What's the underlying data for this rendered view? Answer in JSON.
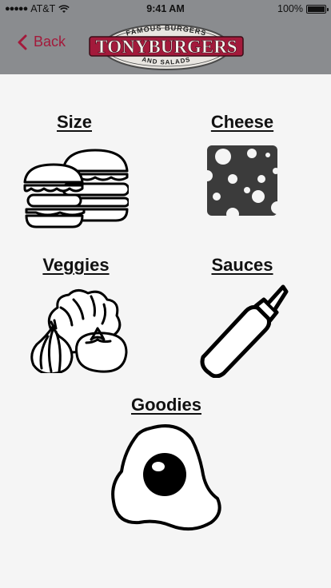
{
  "status_bar": {
    "carrier": "AT&T",
    "time": "9:41 AM",
    "battery_percent": "100%",
    "battery_level": 1.0,
    "signal_icon": "signal-dots-icon",
    "wifi_icon": "wifi-icon"
  },
  "nav": {
    "back_label": "Back",
    "logo": {
      "top_text": "FAMOUS BURGERS",
      "main_text": "TONYBURGERS",
      "bottom_text": "AND SALADS"
    }
  },
  "colors": {
    "accent": "#a31a3b",
    "bar_background": "#8a8c8f",
    "page_background": "#f5f5f5"
  },
  "categories": [
    {
      "label": "Size",
      "icon": "burger-icon"
    },
    {
      "label": "Cheese",
      "icon": "cheese-icon"
    },
    {
      "label": "Veggies",
      "icon": "veggies-icon"
    },
    {
      "label": "Sauces",
      "icon": "sauce-bottle-icon"
    },
    {
      "label": "Goodies",
      "icon": "fried-egg-icon"
    }
  ]
}
